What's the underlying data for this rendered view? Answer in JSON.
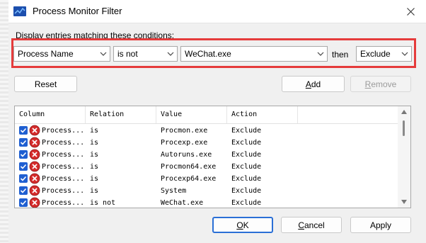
{
  "window": {
    "title": "Process Monitor Filter"
  },
  "filter": {
    "conditions_label": "Display entries matching these conditions:",
    "column_value": "Process Name",
    "relation_value": "is not",
    "value_input": "WeChat.exe",
    "then_label": "then",
    "action_value": "Exclude"
  },
  "buttons": {
    "reset": "Reset",
    "add_pre": "",
    "add_acc": "A",
    "add_post": "dd",
    "remove_pre": "",
    "remove_acc": "R",
    "remove_post": "emove",
    "ok_pre": "",
    "ok_acc": "O",
    "ok_post": "K",
    "cancel_pre": "",
    "cancel_acc": "C",
    "cancel_post": "ancel",
    "apply": "Apply"
  },
  "table": {
    "headers": [
      "Column",
      "Relation",
      "Value",
      "Action"
    ],
    "rows": [
      {
        "column": "Process...",
        "relation": "is",
        "value": "Procmon.exe",
        "action": "Exclude"
      },
      {
        "column": "Process...",
        "relation": "is",
        "value": "Procexp.exe",
        "action": "Exclude"
      },
      {
        "column": "Process...",
        "relation": "is",
        "value": "Autoruns.exe",
        "action": "Exclude"
      },
      {
        "column": "Process...",
        "relation": "is",
        "value": "Procmon64.exe",
        "action": "Exclude"
      },
      {
        "column": "Process...",
        "relation": "is",
        "value": "Procexp64.exe",
        "action": "Exclude"
      },
      {
        "column": "Process...",
        "relation": "is",
        "value": "System",
        "action": "Exclude"
      },
      {
        "column": "Process...",
        "relation": "is not",
        "value": "WeChat.exe",
        "action": "Exclude"
      }
    ]
  },
  "colors": {
    "highlight_border": "#e53b3b",
    "checkbox": "#1f5fd1",
    "exclude_icon": "#d42b2b"
  }
}
